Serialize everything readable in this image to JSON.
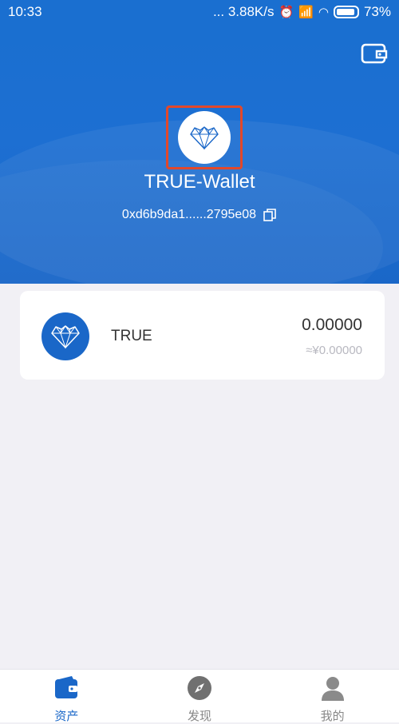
{
  "status_bar": {
    "time": "10:33",
    "network_speed": "... 3.88K/s",
    "battery": "73%"
  },
  "header": {
    "wallet_name": "TRUE-Wallet",
    "address": "0xd6b9da1......2795e08",
    "icons": [
      "wallet-icon",
      "diamond-heart-logo-icon",
      "copy-icon"
    ]
  },
  "tokens": [
    {
      "symbol": "TRUE",
      "balance": "0.00000",
      "fiat": "≈¥0.00000"
    }
  ],
  "tabs": [
    {
      "label": "资产",
      "icon": "wallet-icon",
      "active": true
    },
    {
      "label": "发现",
      "icon": "compass-icon",
      "active": false
    },
    {
      "label": "我的",
      "icon": "person-icon",
      "active": false
    }
  ],
  "colors": {
    "primary": "#1a6fd0",
    "highlight_box": "#e2482a",
    "background": "#f1f0f5"
  }
}
